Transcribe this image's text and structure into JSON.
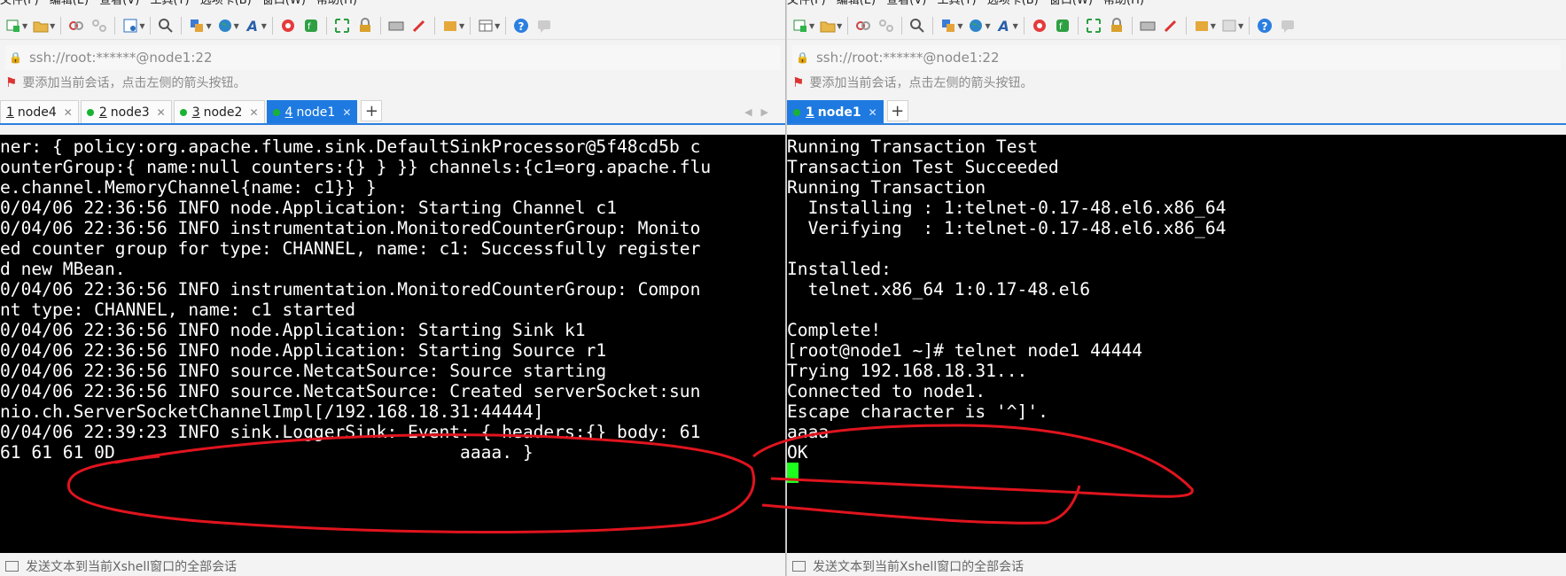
{
  "menu": {
    "left": [
      "文件(F)",
      "编辑(E)",
      "查看(V)",
      "工具(T)",
      "选项卡(B)",
      "窗口(W)",
      "帮助(H)"
    ],
    "right": [
      "文件(F)",
      "编辑(E)",
      "查看(V)",
      "工具(T)",
      "选项卡(B)",
      "窗口(W)",
      "帮助(H)"
    ]
  },
  "toolbar": {
    "icons": [
      "new-session",
      "open-folder",
      "link",
      "unlink",
      "properties",
      "search",
      "transfer",
      "globe",
      "font",
      "xshell",
      "xftp",
      "fullscreen",
      "lock",
      "keyboard",
      "pen",
      "compose",
      "layout",
      "help",
      "chat"
    ]
  },
  "left": {
    "address": "ssh://root:******@node1:22",
    "hint": "要添加当前会话，点击左侧的箭头按钮。",
    "tabs": [
      {
        "num": "1",
        "label": "node4",
        "dot": false,
        "active": false
      },
      {
        "num": "2",
        "label": "node3",
        "dot": true,
        "active": false
      },
      {
        "num": "3",
        "label": "node2",
        "dot": true,
        "active": false
      },
      {
        "num": "4",
        "label": "node1",
        "dot": true,
        "active": true
      }
    ],
    "terminal": [
      "ner: { policy:org.apache.flume.sink.DefaultSinkProcessor@5f48cd5b c",
      "ounterGroup:{ name:null counters:{} } }} channels:{c1=org.apache.flu",
      "e.channel.MemoryChannel{name: c1}} }",
      "0/04/06 22:36:56 INFO node.Application: Starting Channel c1",
      "0/04/06 22:36:56 INFO instrumentation.MonitoredCounterGroup: Monito",
      "ed counter group for type: CHANNEL, name: c1: Successfully register",
      "d new MBean.",
      "0/04/06 22:36:56 INFO instrumentation.MonitoredCounterGroup: Compon",
      "nt type: CHANNEL, name: c1 started",
      "0/04/06 22:36:56 INFO node.Application: Starting Sink k1",
      "0/04/06 22:36:56 INFO node.Application: Starting Source r1",
      "0/04/06 22:36:56 INFO source.NetcatSource: Source starting",
      "0/04/06 22:36:56 INFO source.NetcatSource: Created serverSocket:sun",
      "nio.ch.ServerSocketChannelImpl[/192.168.18.31:44444]",
      "0/04/06 22:39:23 INFO sink.LoggerSink: Event: { headers:{} body: 61",
      "61 61 61 0D                                 aaaa. }"
    ],
    "status": "发送文本到当前Xshell窗口的全部会话"
  },
  "right": {
    "address": "ssh://root:******@node1:22",
    "hint": "要添加当前会话，点击左侧的箭头按钮。",
    "tabs": [
      {
        "num": "1",
        "label": "node1",
        "dot": true,
        "active": true
      }
    ],
    "terminal": [
      "Running Transaction Test",
      "Transaction Test Succeeded",
      "Running Transaction",
      "  Installing : 1:telnet-0.17-48.el6.x86_64",
      "  Verifying  : 1:telnet-0.17-48.el6.x86_64",
      "",
      "Installed:",
      "  telnet.x86_64 1:0.17-48.el6",
      "",
      "Complete!",
      "[root@node1 ~]# telnet node1 44444",
      "Trying 192.168.18.31...",
      "Connected to node1.",
      "Escape character is '^]'.",
      "aaaa",
      "OK"
    ],
    "status": "发送文本到当前Xshell窗口的全部会话"
  },
  "colors": {
    "accent": "#1e7ae0",
    "session_dot": "#19b233",
    "cursor": "#1cff1c",
    "annotation": "#e0141e"
  }
}
